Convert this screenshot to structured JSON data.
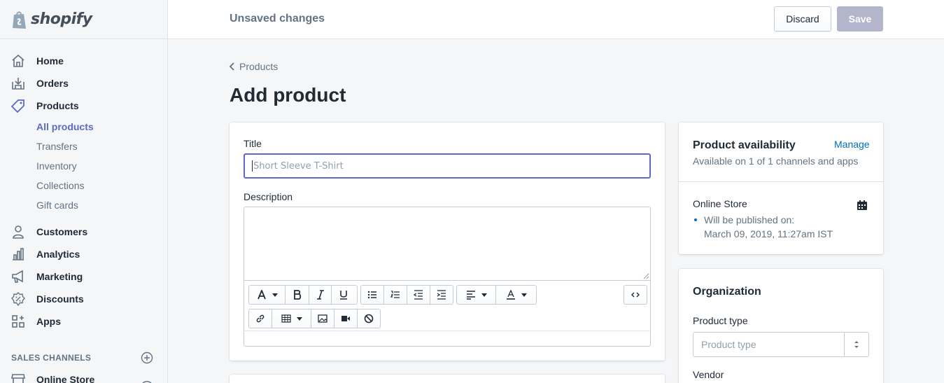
{
  "app": {
    "logo_text": "shopify"
  },
  "topbar": {
    "status": "Unsaved changes",
    "discard_label": "Discard",
    "save_label": "Save"
  },
  "sidebar": {
    "items": [
      {
        "label": "Home",
        "icon": "home-icon"
      },
      {
        "label": "Orders",
        "icon": "orders-icon"
      },
      {
        "label": "Products",
        "icon": "tag-icon"
      },
      {
        "label": "Customers",
        "icon": "person-icon"
      },
      {
        "label": "Analytics",
        "icon": "bar-chart-icon"
      },
      {
        "label": "Marketing",
        "icon": "megaphone-icon"
      },
      {
        "label": "Discounts",
        "icon": "discount-icon"
      },
      {
        "label": "Apps",
        "icon": "apps-icon"
      }
    ],
    "sub_items": [
      {
        "label": "All products",
        "active": true
      },
      {
        "label": "Transfers"
      },
      {
        "label": "Inventory"
      },
      {
        "label": "Collections"
      },
      {
        "label": "Gift cards"
      }
    ],
    "sales_channels_label": "SALES CHANNELS",
    "channels": [
      {
        "label": "Online Store"
      }
    ]
  },
  "main": {
    "breadcrumb": "Products",
    "page_title": "Add product",
    "title_label": "Title",
    "title_placeholder": "Short Sleeve T-Shirt",
    "description_label": "Description"
  },
  "availability": {
    "title": "Product availability",
    "manage_label": "Manage",
    "summary": "Available on 1 of 1 channels and apps",
    "channel_name": "Online Store",
    "publish_line": "Will be published on:",
    "publish_date": "March 09, 2019, 11:27am IST"
  },
  "organization": {
    "title": "Organization",
    "product_type_label": "Product type",
    "product_type_placeholder": "Product type",
    "vendor_label": "Vendor"
  },
  "colors": {
    "accent": "#5c6ac4",
    "link": "#006fbb",
    "save_disabled": "#b3b5cb"
  }
}
